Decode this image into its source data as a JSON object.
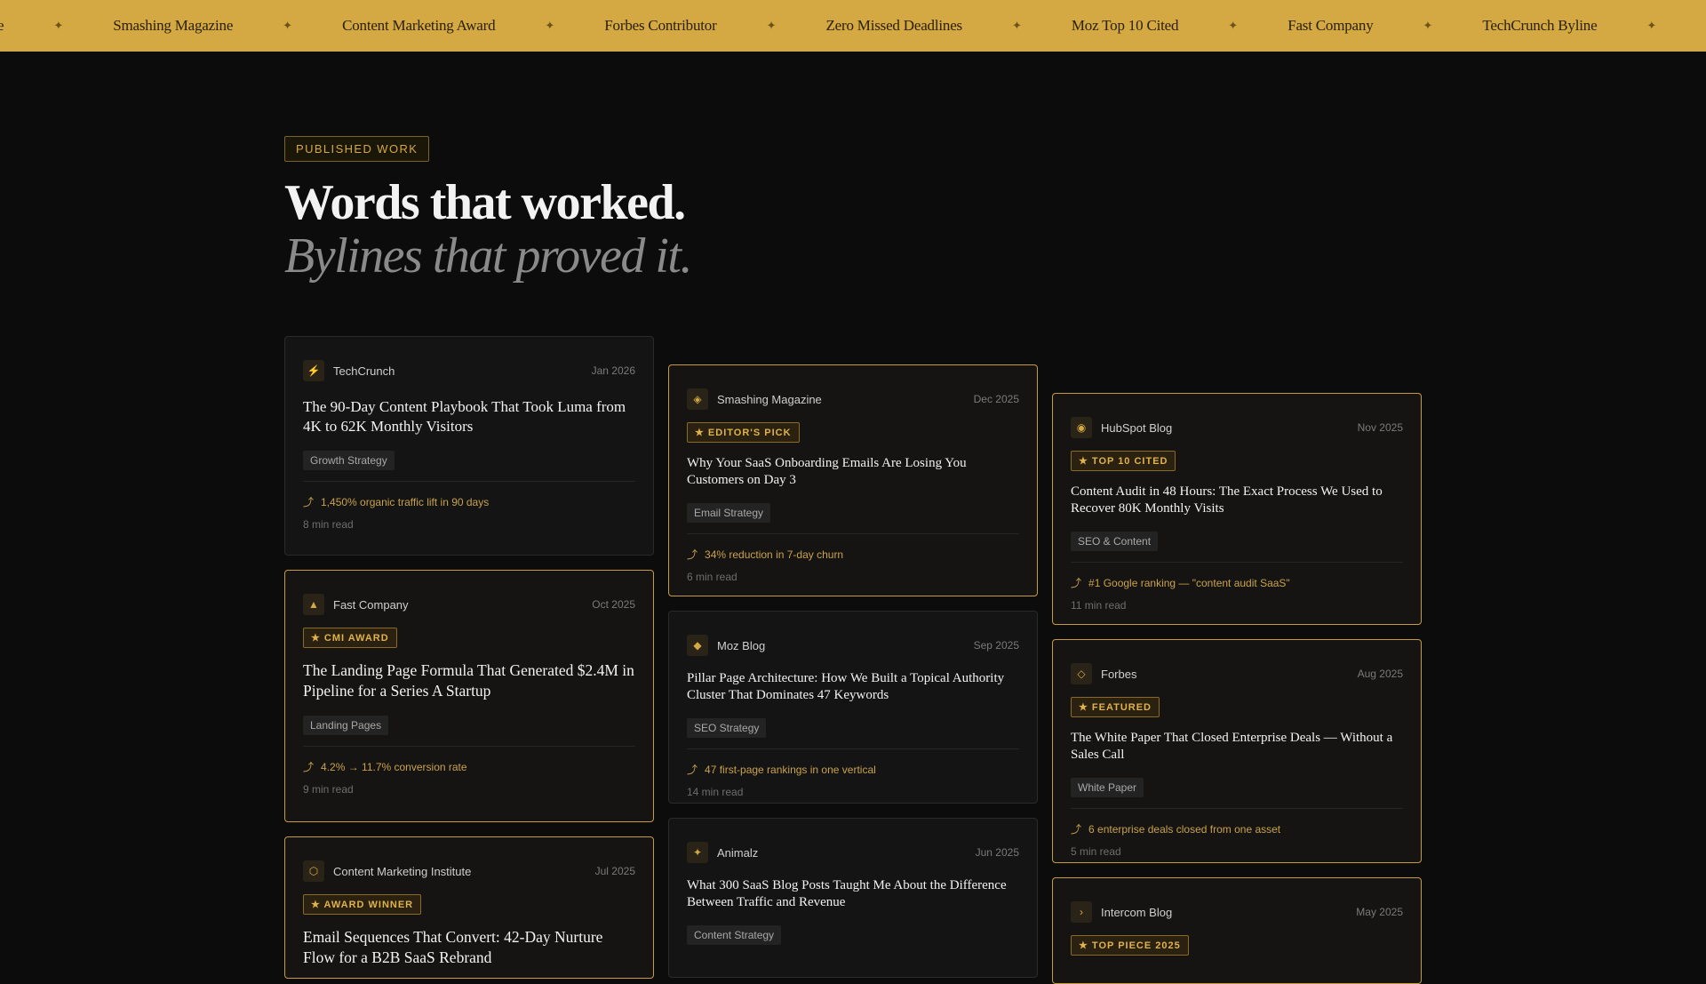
{
  "ticker": {
    "items": [
      "eature",
      "Smashing Magazine",
      "Content Marketing Award",
      "Forbes Contributor",
      "Zero Missed Deadlines",
      "Moz Top 10 Cited",
      "Fast Company",
      "TechCrunch Byline"
    ]
  },
  "hero": {
    "badge": "PUBLISHED WORK",
    "line1": "Words that worked.",
    "line2": "Bylines that proved it."
  },
  "cards": [
    {
      "source": "TechCrunch",
      "icon": "⚡",
      "date": "Jan 2026",
      "award": "",
      "title": "The 90-Day Content Playbook That Took Luma from 4K to 62K Monthly Visitors",
      "tag": "Growth Strategy",
      "metric": "1,450% organic traffic lift in 90 days",
      "read": "8 min read"
    },
    {
      "source": "Smashing Magazine",
      "icon": "◈",
      "date": "Dec 2025",
      "award": "★ EDITOR'S PICK",
      "title": "Why Your SaaS Onboarding Emails Are Losing You Customers on Day 3",
      "tag": "Email Strategy",
      "metric": "34% reduction in 7-day churn",
      "read": "6 min read"
    },
    {
      "source": "HubSpot Blog",
      "icon": "◉",
      "date": "Nov 2025",
      "award": "★ TOP 10 CITED",
      "title": "Content Audit in 48 Hours: The Exact Process We Used to Recover 80K Monthly Visits",
      "tag": "SEO & Content",
      "metric": "#1 Google ranking — \"content audit SaaS\"",
      "read": "11 min read"
    },
    {
      "source": "Fast Company",
      "icon": "▲",
      "date": "Oct 2025",
      "award": "★ CMI AWARD",
      "title": "The Landing Page Formula That Generated $2.4M in Pipeline for a Series A Startup",
      "tag": "Landing Pages",
      "metric": "4.2% → 11.7% conversion rate",
      "read": "9 min read"
    },
    {
      "source": "Moz Blog",
      "icon": "◆",
      "date": "Sep 2025",
      "award": "",
      "title": "Pillar Page Architecture: How We Built a Topical Authority Cluster That Dominates 47 Keywords",
      "tag": "SEO Strategy",
      "metric": "47 first-page rankings in one vertical",
      "read": "14 min read"
    },
    {
      "source": "Forbes",
      "icon": "◇",
      "date": "Aug 2025",
      "award": "★ FEATURED",
      "title": "The White Paper That Closed Enterprise Deals — Without a Sales Call",
      "tag": "White Paper",
      "metric": "6 enterprise deals closed from one asset",
      "read": "5 min read"
    },
    {
      "source": "Content Marketing Institute",
      "icon": "⬡",
      "date": "Jul 2025",
      "award": "★ AWARD WINNER",
      "title": "Email Sequences That Convert: 42-Day Nurture Flow for a B2B SaaS Rebrand",
      "tag": "",
      "metric": "",
      "read": ""
    },
    {
      "source": "Animalz",
      "icon": "✦",
      "date": "Jun 2025",
      "award": "",
      "title": "What 300 SaaS Blog Posts Taught Me About the Difference Between Traffic and Revenue",
      "tag": "Content Strategy",
      "metric": "",
      "read": ""
    },
    {
      "source": "Intercom Blog",
      "icon": "›",
      "date": "May 2025",
      "award": "★ TOP PIECE 2025",
      "title": "",
      "tag": "",
      "metric": "",
      "read": ""
    }
  ]
}
